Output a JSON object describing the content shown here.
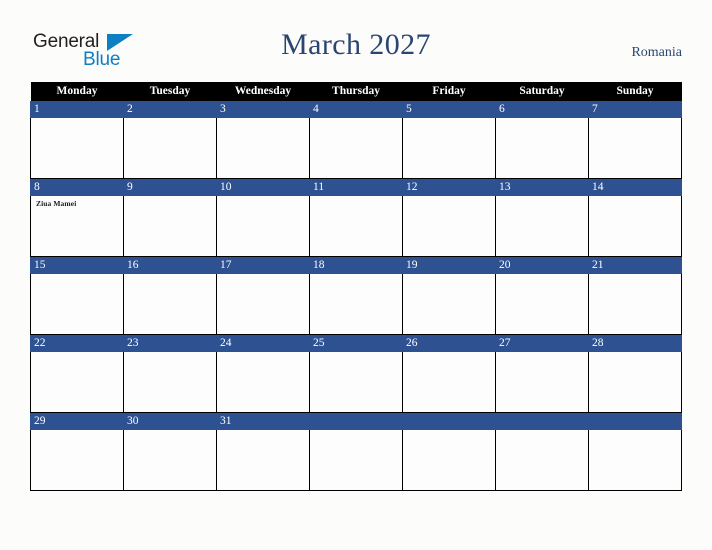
{
  "header": {
    "logo": {
      "word1": "General",
      "word2": "Blue",
      "triangle_color": "#0f7fc4"
    },
    "title": "March 2027",
    "country": "Romania"
  },
  "calendar": {
    "weekday_headers": [
      "Monday",
      "Tuesday",
      "Wednesday",
      "Thursday",
      "Friday",
      "Saturday",
      "Sunday"
    ],
    "accent_color": "#2e5191",
    "header_bg": "#000000",
    "weeks": [
      [
        {
          "day": "1",
          "events": []
        },
        {
          "day": "2",
          "events": []
        },
        {
          "day": "3",
          "events": []
        },
        {
          "day": "4",
          "events": []
        },
        {
          "day": "5",
          "events": []
        },
        {
          "day": "6",
          "events": []
        },
        {
          "day": "7",
          "events": []
        }
      ],
      [
        {
          "day": "8",
          "events": [
            "Ziua Mamei"
          ]
        },
        {
          "day": "9",
          "events": []
        },
        {
          "day": "10",
          "events": []
        },
        {
          "day": "11",
          "events": []
        },
        {
          "day": "12",
          "events": []
        },
        {
          "day": "13",
          "events": []
        },
        {
          "day": "14",
          "events": []
        }
      ],
      [
        {
          "day": "15",
          "events": []
        },
        {
          "day": "16",
          "events": []
        },
        {
          "day": "17",
          "events": []
        },
        {
          "day": "18",
          "events": []
        },
        {
          "day": "19",
          "events": []
        },
        {
          "day": "20",
          "events": []
        },
        {
          "day": "21",
          "events": []
        }
      ],
      [
        {
          "day": "22",
          "events": []
        },
        {
          "day": "23",
          "events": []
        },
        {
          "day": "24",
          "events": []
        },
        {
          "day": "25",
          "events": []
        },
        {
          "day": "26",
          "events": []
        },
        {
          "day": "27",
          "events": []
        },
        {
          "day": "28",
          "events": []
        }
      ],
      [
        {
          "day": "29",
          "events": []
        },
        {
          "day": "30",
          "events": []
        },
        {
          "day": "31",
          "events": []
        },
        {
          "day": "",
          "events": []
        },
        {
          "day": "",
          "events": []
        },
        {
          "day": "",
          "events": []
        },
        {
          "day": "",
          "events": []
        }
      ]
    ]
  }
}
